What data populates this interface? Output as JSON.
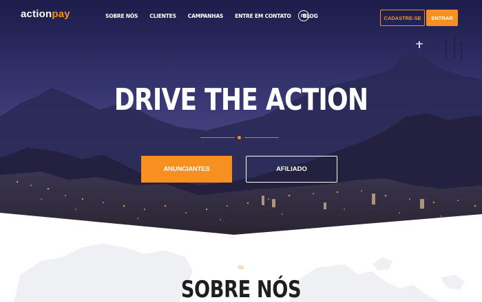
{
  "header": {
    "logo_main": "action",
    "logo_accent": "pay",
    "nav": [
      {
        "label": "SOBRE NÓS"
      },
      {
        "label": "CLIENTES"
      },
      {
        "label": "CAMPANHAS"
      },
      {
        "label": "ENTRE EM CONTATO"
      },
      {
        "label": "BLOG"
      }
    ],
    "language": "PT",
    "signup_label": "CADASTRE-SE",
    "login_label": "ENTRAR"
  },
  "hero": {
    "title": "DRIVE THE ACTION",
    "primary_button": "ANUNCIANTES",
    "secondary_button": "AFILIADO"
  },
  "section": {
    "number": "01",
    "title": "SOBRE NÓS"
  },
  "colors": {
    "accent": "#f7901e",
    "dark_text": "#1e1e1e"
  }
}
